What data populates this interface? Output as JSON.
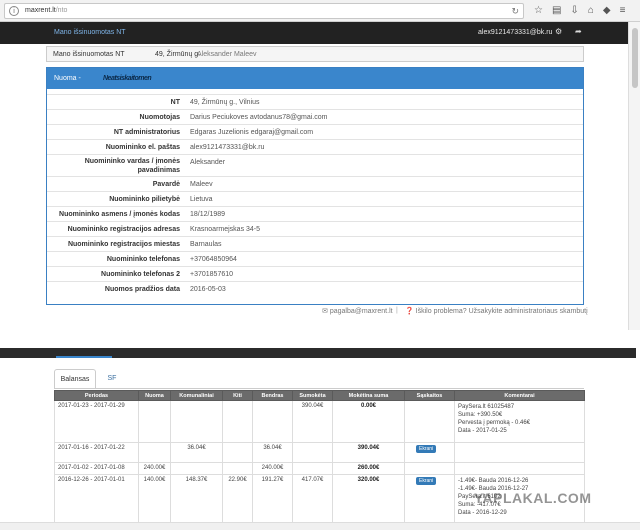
{
  "browser": {
    "url_host": "maxrent.lt",
    "url_path": "/nto",
    "info_icon": "i"
  },
  "navbar": {
    "brand": "Mano išsinuomotas NT",
    "user_email": "alex9121473331@bk.ru"
  },
  "breadcrumb": {
    "section": "Mano išsinuomotas NT",
    "address": "49, Žirmūnų g.",
    "tenant": "Aleksander Maleev"
  },
  "panel": {
    "title_prefix": "Nuoma -",
    "title_overlay": "Neatsiskaitomen",
    "rows": [
      {
        "label": "NT",
        "value": "49, Žirmūnų g., Vilnius"
      },
      {
        "label": "Nuomotojas",
        "value": "Darius Peciukoves avtodanus78@gmai.com"
      },
      {
        "label": "NT administratorius",
        "value": "Edgaras Juzelionis edgaraj@gmail.com"
      },
      {
        "label": "Nuomininko el. paštas",
        "value": "alex9121473331@bk.ru"
      },
      {
        "label": "Nuomininko vardas / įmonės pavadinimas",
        "value": "Aleksander"
      },
      {
        "label": "Pavardė",
        "value": "Maleev"
      },
      {
        "label": "Nuomininko pilietybė",
        "value": "Lietuva"
      },
      {
        "label": "Nuomininko asmens / įmonės kodas",
        "value": "18/12/1989"
      },
      {
        "label": "Nuomininko registracijos adresas",
        "value": "Krasnoarmejskas 34-5"
      },
      {
        "label": "Nuomininko registracijos miestas",
        "value": "Barnaulas"
      },
      {
        "label": "Nuomininko telefonas",
        "value": "+37064850964"
      },
      {
        "label": "Nuomininko telefonas 2",
        "value": "+3701857610"
      },
      {
        "label": "Nuomos pradžios data",
        "value": "2016-05-03"
      }
    ]
  },
  "footer": {
    "support_email": "pagalba@maxrent.lt",
    "separator": "|",
    "problem_text": "Iškilo problema? Užsakykite administratoriaus skambutį"
  },
  "balance": {
    "tabs": [
      "Balansas",
      "SF"
    ],
    "columns": [
      "Periodas",
      "Nuoma",
      "Komunaliniai",
      "Kiti",
      "Bendras",
      "Sumokėta",
      "Mokėtina suma",
      "Sąskaitos",
      "Komentarai"
    ],
    "rows": [
      {
        "period": "2017-01-23 - 2017-01-29",
        "nuoma": "",
        "komunaliniai": "",
        "kiti": "",
        "bendras": "",
        "sumoketa": "390.04€",
        "moketina": "0.00€",
        "button": "",
        "comments": [
          "PaySera.lt 61025487",
          "Suma: +390.50€",
          "Pervesta į permoką - 0.46€",
          "Data - 2017-01-25"
        ]
      },
      {
        "period": "2017-01-16 - 2017-01-22",
        "nuoma": "",
        "komunaliniai": "36.04€",
        "kiti": "",
        "bendras": "36.04€",
        "sumoketa": "",
        "moketina": "390.04€",
        "button": "Ekrani",
        "comments": []
      },
      {
        "period": "2017-01-02 - 2017-01-08",
        "nuoma": "240.00€",
        "komunaliniai": "",
        "kiti": "",
        "bendras": "240.00€",
        "sumoketa": "",
        "moketina": "260.00€",
        "button": "",
        "comments": []
      },
      {
        "period": "2016-12-26 - 2017-01-01",
        "nuoma": "140.00€",
        "komunaliniai": "148.37€",
        "kiti": "22.90€",
        "bendras": "191.27€",
        "sumoketa": "417.07€",
        "moketina": "320.00€",
        "button": "Ekrani",
        "comments": [
          "-1.49€- Bauda 2016-12-26",
          "-1.49€- Bauda 2016-12-27",
          "PaySera.lt 6102",
          "Suma: -417.07€",
          "Data - 2016-12-29"
        ]
      }
    ]
  },
  "watermark": "YAPLAKAL.COM",
  "colors": {
    "navbar": "#222222",
    "panel_header": "#3a86cc",
    "table_header": "#6b6b6b",
    "button": "#337ab7"
  }
}
